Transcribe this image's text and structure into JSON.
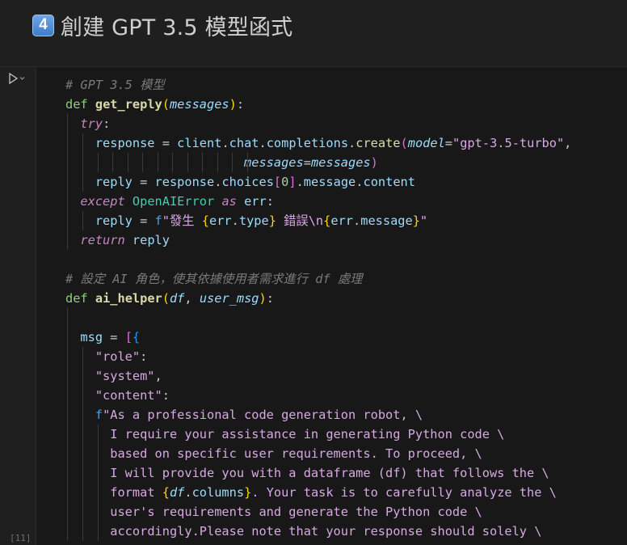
{
  "markdown": {
    "keycap": "4",
    "title": "創建 GPT 3.5 模型函式"
  },
  "cell": {
    "execution_count": "[11]"
  },
  "code": {
    "l1": "# GPT 3.5 模型",
    "l2_def": "def",
    "l2_fn": "get_reply",
    "l2_p": "messages",
    "l3_try": "try",
    "l4_a": "response",
    "l4_b": "client",
    "l4_c": "chat",
    "l4_d": "completions",
    "l4_e": "create",
    "l4_kw": "model",
    "l4_str": "\"gpt-3.5-turbo\"",
    "l5_kw": "messages",
    "l5_val": "messages",
    "l6_a": "reply",
    "l6_b": "response",
    "l6_c": "choices",
    "l6_num": "0",
    "l6_d": "message",
    "l6_e": "content",
    "l7_except": "except",
    "l7_cls": "OpenAIError",
    "l7_as": "as",
    "l7_err": "err",
    "l8_reply": "reply",
    "l8_f": "f",
    "l8_s1": "\"發生 ",
    "l8_e1": "err",
    "l8_t": "type",
    "l8_s2": " 錯誤\\n",
    "l8_e2": "err",
    "l8_m": "message",
    "l8_s3": "\"",
    "l9_return": "return",
    "l9_reply": "reply",
    "l11": "# 設定 AI 角色，使其依據使用者需求進行 df 處理",
    "l12_def": "def",
    "l12_fn": "ai_helper",
    "l12_p1": "df",
    "l12_p2": "user_msg",
    "l14_msg": "msg",
    "l15": "\"role\"",
    "l16": "\"system\"",
    "l17": "\"content\"",
    "l18_f": "f",
    "l18": "\"As a professional code generation robot, \\",
    "l19": "I require your assistance in generating Python code \\",
    "l20": "based on specific user requirements. To proceed, \\",
    "l21": "I will provide you with a dataframe (df) that follows the \\",
    "l22_a": "format ",
    "l22_df": "df",
    "l22_col": "columns",
    "l22_b": ". Your task is to carefully analyze the \\",
    "l23": "user's requirements and generate the Python code \\",
    "l24": "accordingly.Please note that your response should solely \\"
  }
}
